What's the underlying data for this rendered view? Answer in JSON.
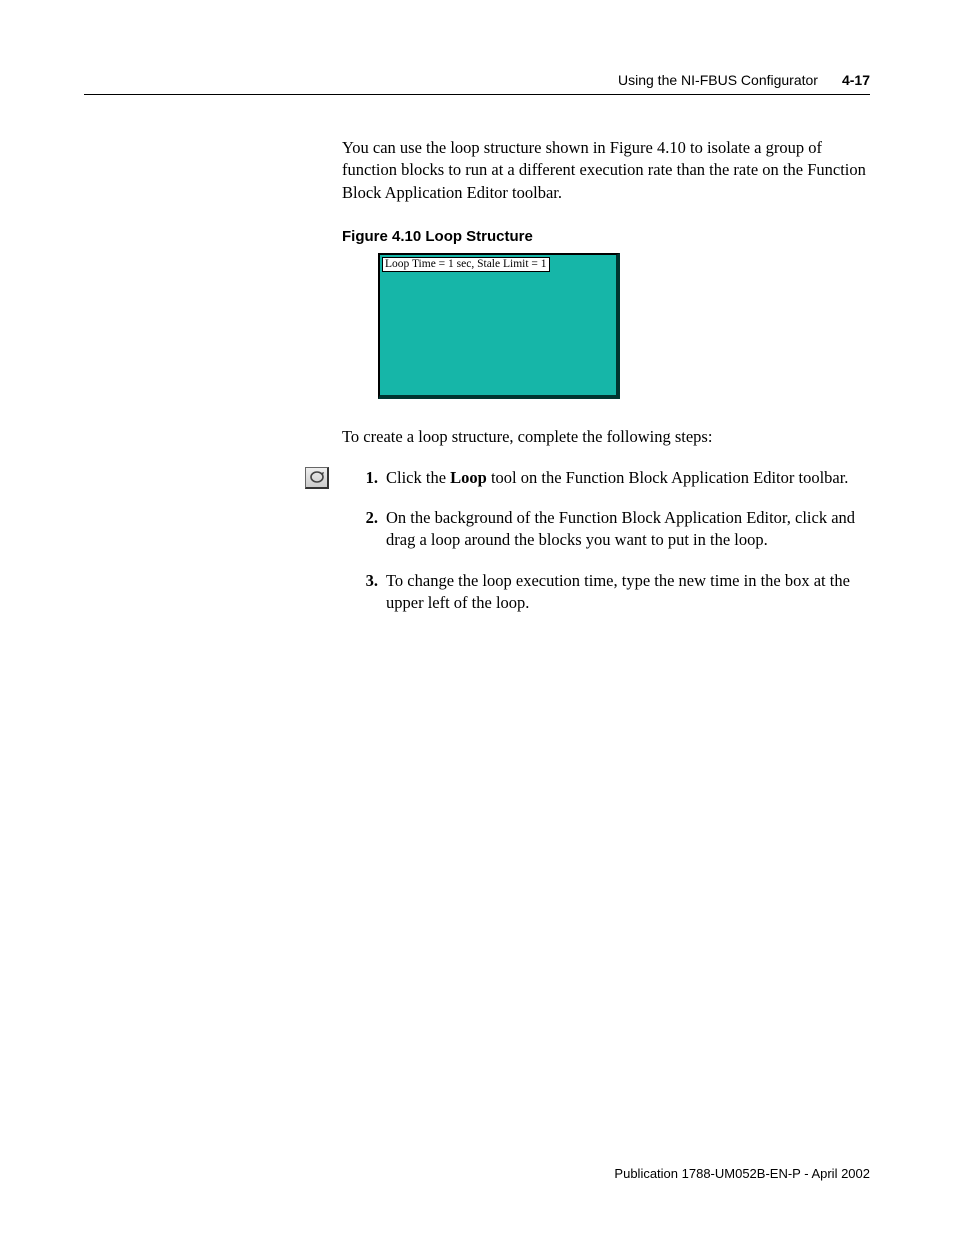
{
  "header": {
    "section_title": "Using the NI-FBUS Configurator",
    "page_number": "4-17"
  },
  "intro_paragraph": "You can use the loop structure shown in Figure 4.10 to isolate a group of function blocks to run at a different execution rate than the rate on the Function Block Application Editor toolbar.",
  "figure": {
    "caption": "Figure 4.10 Loop Structure",
    "box_label": "Loop Time = 1 sec, Stale Limit = 1"
  },
  "lead_in": "To create a loop structure, complete the following steps:",
  "margin_icon_name": "loop-tool-icon",
  "steps": [
    {
      "num": "1.",
      "prefix": "Click the ",
      "bold": "Loop",
      "suffix": " tool on the Function Block Application Editor toolbar."
    },
    {
      "num": "2.",
      "prefix": "On the background of the Function Block Application Editor, click and drag a loop around the blocks you want to put in the loop.",
      "bold": "",
      "suffix": ""
    },
    {
      "num": "3.",
      "prefix": "To change the loop execution time, type the new time in the box at the upper left of the loop.",
      "bold": "",
      "suffix": ""
    }
  ],
  "footer": "Publication 1788-UM052B-EN-P - April 2002"
}
